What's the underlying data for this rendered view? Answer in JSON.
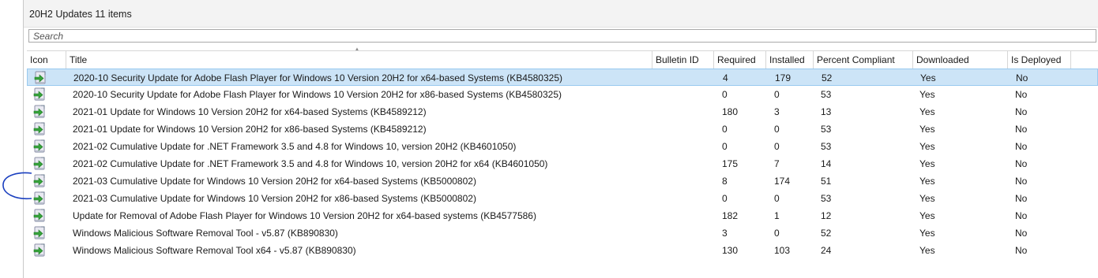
{
  "header": {
    "title": "20H2 Updates 11 items"
  },
  "search": {
    "placeholder": "Search"
  },
  "columns": [
    "Icon",
    "Title",
    "Bulletin ID",
    "Required",
    "Installed",
    "Percent Compliant",
    "Downloaded",
    "Is Deployed"
  ],
  "rows": [
    {
      "title": "2020-10 Security Update for Adobe Flash Player for Windows 10 Version 20H2 for x64-based Systems (KB4580325)",
      "bulletin": "",
      "required": "4",
      "installed": "179",
      "percent": "52",
      "downloaded": "Yes",
      "deployed": "No",
      "icon": "software-update-icon"
    },
    {
      "title": "2020-10 Security Update for Adobe Flash Player for Windows 10 Version 20H2 for x86-based Systems (KB4580325)",
      "bulletin": "",
      "required": "0",
      "installed": "0",
      "percent": "53",
      "downloaded": "Yes",
      "deployed": "No",
      "icon": "software-update-icon"
    },
    {
      "title": "2021-01 Update for Windows 10 Version 20H2 for x64-based Systems (KB4589212)",
      "bulletin": "",
      "required": "180",
      "installed": "3",
      "percent": "13",
      "downloaded": "Yes",
      "deployed": "No",
      "icon": "software-update-icon"
    },
    {
      "title": "2021-01 Update for Windows 10 Version 20H2 for x86-based Systems (KB4589212)",
      "bulletin": "",
      "required": "0",
      "installed": "0",
      "percent": "53",
      "downloaded": "Yes",
      "deployed": "No",
      "icon": "software-update-icon"
    },
    {
      "title": "2021-02 Cumulative Update for .NET Framework 3.5 and 4.8 for Windows 10, version 20H2 (KB4601050)",
      "bulletin": "",
      "required": "0",
      "installed": "0",
      "percent": "53",
      "downloaded": "Yes",
      "deployed": "No",
      "icon": "software-update-icon"
    },
    {
      "title": "2021-02 Cumulative Update for .NET Framework 3.5 and 4.8 for Windows 10, version 20H2 for x64 (KB4601050)",
      "bulletin": "",
      "required": "175",
      "installed": "7",
      "percent": "14",
      "downloaded": "Yes",
      "deployed": "No",
      "icon": "software-update-icon"
    },
    {
      "title": "2021-03 Cumulative Update for Windows 10 Version 20H2 for x64-based Systems (KB5000802)",
      "bulletin": "",
      "required": "8",
      "installed": "174",
      "percent": "51",
      "downloaded": "Yes",
      "deployed": "No",
      "icon": "software-update-icon"
    },
    {
      "title": "2021-03 Cumulative Update for Windows 10 Version 20H2 for x86-based Systems (KB5000802)",
      "bulletin": "",
      "required": "0",
      "installed": "0",
      "percent": "53",
      "downloaded": "Yes",
      "deployed": "No",
      "icon": "software-update-icon"
    },
    {
      "title": "Update for Removal of Adobe Flash Player for Windows 10 Version 20H2 for x64-based systems (KB4577586)",
      "bulletin": "",
      "required": "182",
      "installed": "1",
      "percent": "12",
      "downloaded": "Yes",
      "deployed": "No",
      "icon": "software-update-icon"
    },
    {
      "title": "Windows Malicious Software Removal Tool - v5.87 (KB890830)",
      "bulletin": "",
      "required": "3",
      "installed": "0",
      "percent": "52",
      "downloaded": "Yes",
      "deployed": "No",
      "icon": "software-update-icon"
    },
    {
      "title": "Windows Malicious Software Removal Tool x64 - v5.87 (KB890830)",
      "bulletin": "",
      "required": "130",
      "installed": "103",
      "percent": "24",
      "downloaded": "Yes",
      "deployed": "No",
      "icon": "software-update-icon"
    }
  ],
  "selected_row": 0,
  "colors": {
    "selection": "#cce4f7",
    "selection_border": "#99c9ef",
    "annotation": "#1a3fbf",
    "icon_green": "#37a33b"
  }
}
